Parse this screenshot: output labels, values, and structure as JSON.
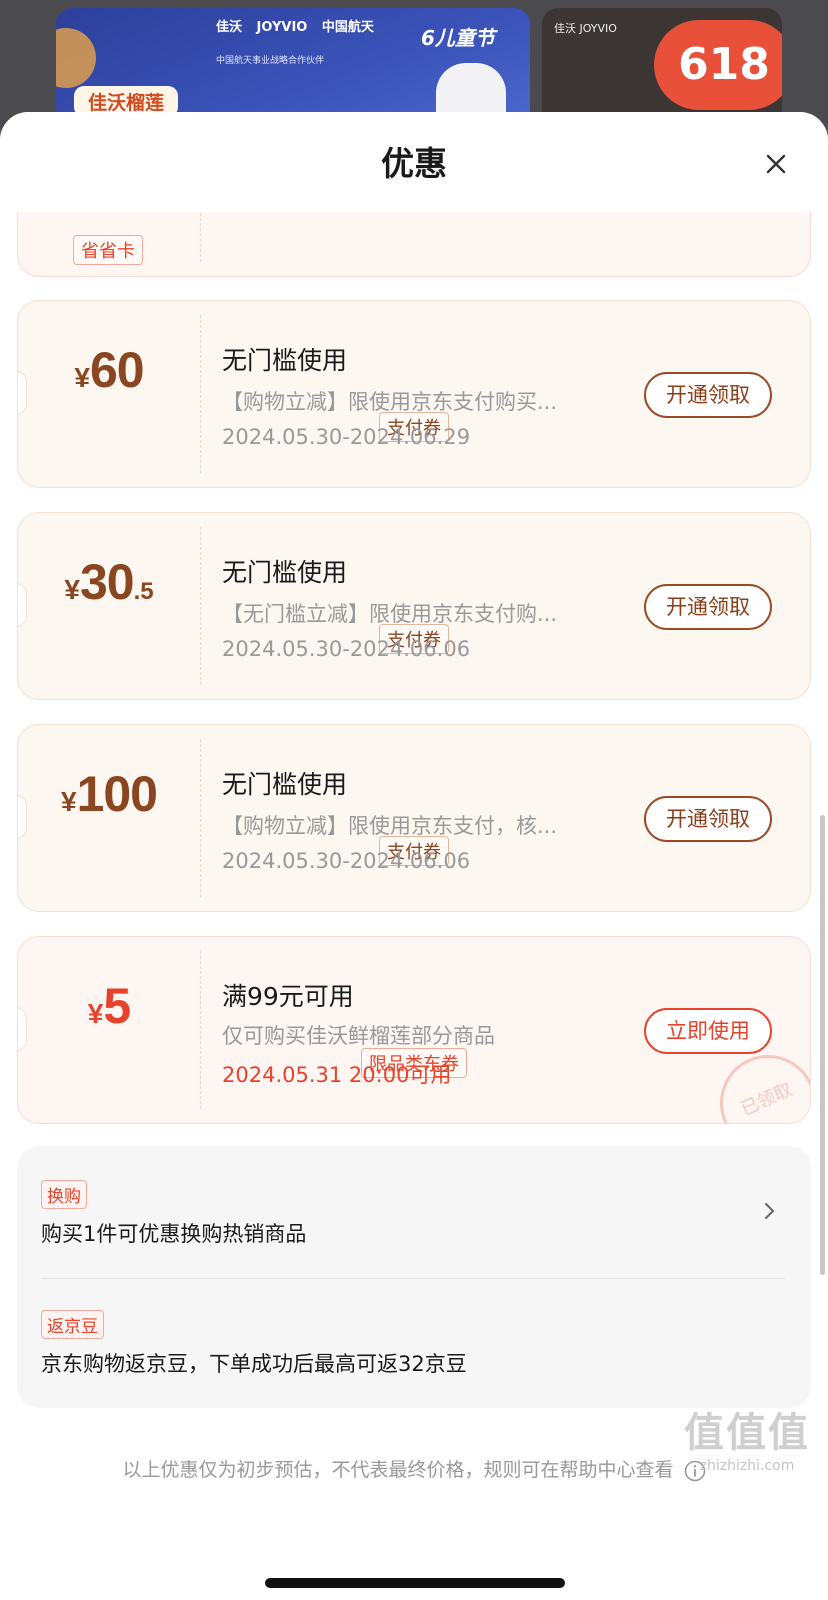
{
  "background_banners": {
    "left": {
      "brand": "佳沃",
      "brand_en": "JOYVIO",
      "partner": "中国航天",
      "subtitle": "中国航天事业战略合作伙伴",
      "festival": "6儿童节",
      "product": "佳沃榴莲"
    },
    "right": {
      "brand": "佳沃",
      "brand_en": "JOYVIO",
      "badge": "618"
    }
  },
  "sheet": {
    "title": "优惠",
    "close_icon": "close-icon"
  },
  "partial_coupon": {
    "tag": "省省卡"
  },
  "coupons": [
    {
      "symbol": "¥",
      "integer": "60",
      "decimal": "",
      "tag": "支付券",
      "title": "无门槛使用",
      "desc": "【购物立减】限使用京东支付购买...",
      "date": "2024.05.30-2024.06.29",
      "button": "开通领取"
    },
    {
      "symbol": "¥",
      "integer": "30",
      "decimal": ".5",
      "tag": "支付券",
      "title": "无门槛使用",
      "desc": "【无门槛立减】限使用京东支付购...",
      "date": "2024.05.30-2024.06.06",
      "button": "开通领取"
    },
    {
      "symbol": "¥",
      "integer": "100",
      "decimal": "",
      "tag": "支付券",
      "title": "无门槛使用",
      "desc": "【购物立减】限使用京东支付，核...",
      "date": "2024.05.30-2024.06.06",
      "button": "开通领取"
    },
    {
      "symbol": "¥",
      "integer": "5",
      "decimal": "",
      "tag": "限品类东券",
      "title": "满99元可用",
      "desc": "仅可购买佳沃鲜榴莲部分商品",
      "date": "2024.05.31 20:00可用",
      "button": "立即使用",
      "stamp": "已领取"
    }
  ],
  "promotions": [
    {
      "tag": "换购",
      "text": "购买1件可优惠换购热销商品"
    },
    {
      "tag": "返京豆",
      "text": "京东购物返京豆，下单成功后最高可返32京豆"
    }
  ],
  "footnote": "以上优惠仅为初步预估，不代表最终价格，规则可在帮助中心查看",
  "watermark": {
    "logo": "值值值",
    "site": "zhizhizhi.com"
  },
  "colors": {
    "accent_brown": "#8a3e1a",
    "accent_red": "#e8432a",
    "coupon_bg": "#fdf7f2"
  }
}
